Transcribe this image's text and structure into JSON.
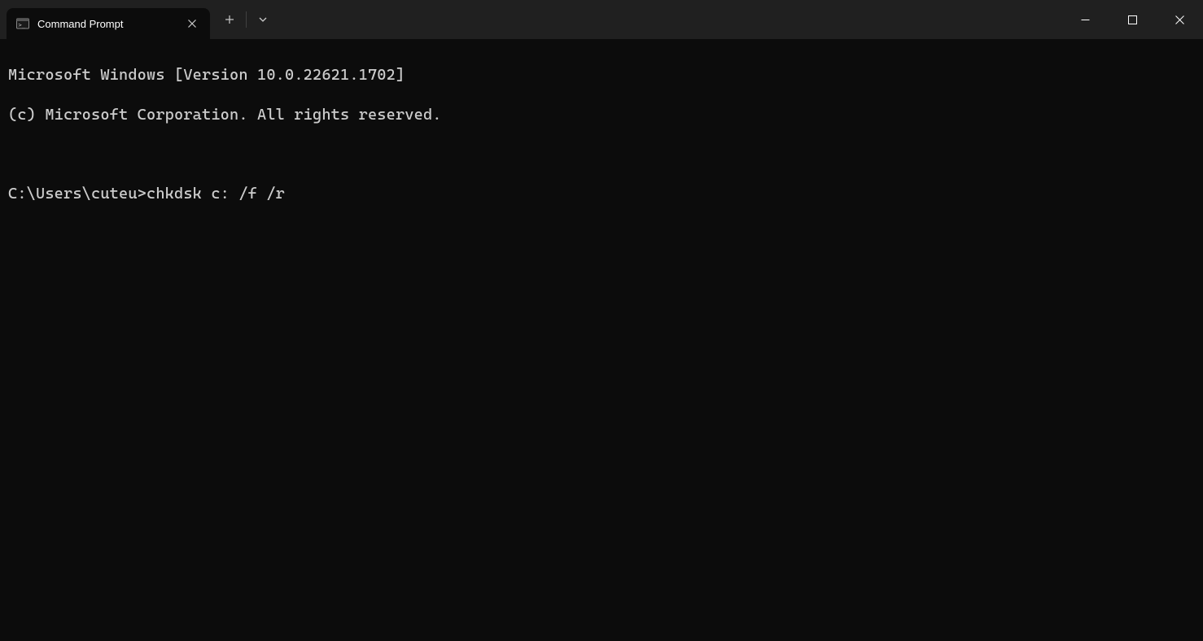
{
  "tab": {
    "title": "Command Prompt"
  },
  "terminal": {
    "line1": "Microsoft Windows [Version 10.0.22621.1702]",
    "line2": "(c) Microsoft Corporation. All rights reserved.",
    "prompt": "C:\\Users\\cuteu>",
    "command": "chkdsk c: /f /r"
  }
}
